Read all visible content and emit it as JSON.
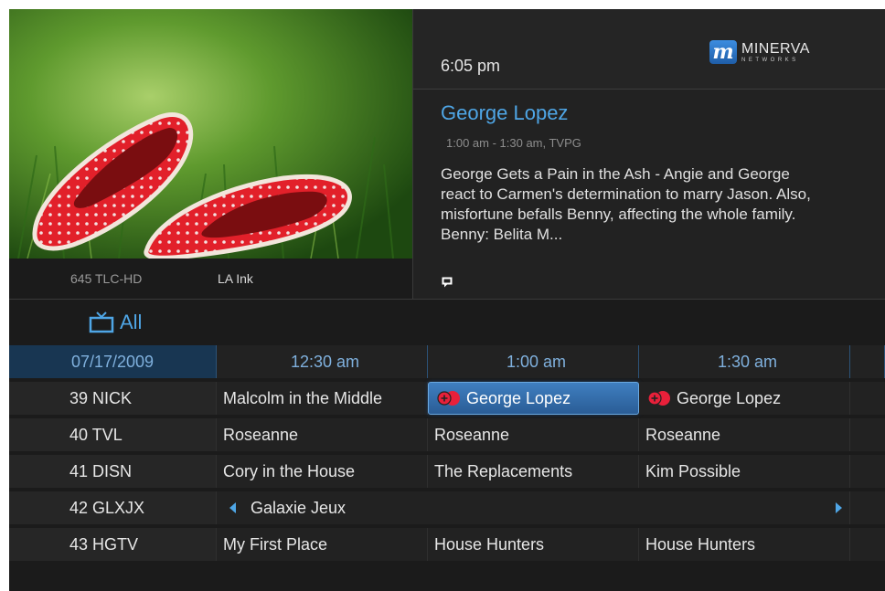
{
  "now_time": "6:05 pm",
  "logo": {
    "main": "MINERVA",
    "sub": "NETWORKS",
    "mark": "m"
  },
  "preview": {
    "channel": "645  TLC-HD",
    "show": "LA Ink"
  },
  "program": {
    "title": "George Lopez",
    "time_rating": "1:00 am - 1:30 am, TVPG",
    "description": "George Gets a Pain in the Ash - Angie and George react to Carmen's determination to marry Jason. Also, misfortune befalls Benny, affecting the whole family. Benny: Belita M..."
  },
  "filter": {
    "label": "All",
    "icon": "tv-icon"
  },
  "guide": {
    "header": {
      "date": "07/17/2009",
      "slots": [
        "12:30 am",
        "1:00 am",
        "1:30 am"
      ]
    },
    "rows": [
      {
        "channel": "39 NICK",
        "c1": "Malcolm in the Middle",
        "c2": "George Lopez",
        "c3": "George Lopez"
      },
      {
        "channel": "40 TVL",
        "c1": "Roseanne",
        "c2": "Roseanne",
        "c3": "Roseanne"
      },
      {
        "channel": "41 DISN",
        "c1": "Cory in the House",
        "c2": "The Replacements",
        "c3": "Kim Possible"
      },
      {
        "channel": "42 GLXJX",
        "span": "Galaxie Jeux"
      },
      {
        "channel": "43 HGTV",
        "c1": "My First Place",
        "c2": "House Hunters",
        "c3": "House Hunters"
      }
    ]
  },
  "colors": {
    "accent": "#4fa6e6",
    "header_bg": "#183652",
    "selected": "#3f7fc0",
    "record": "#e8203a"
  }
}
